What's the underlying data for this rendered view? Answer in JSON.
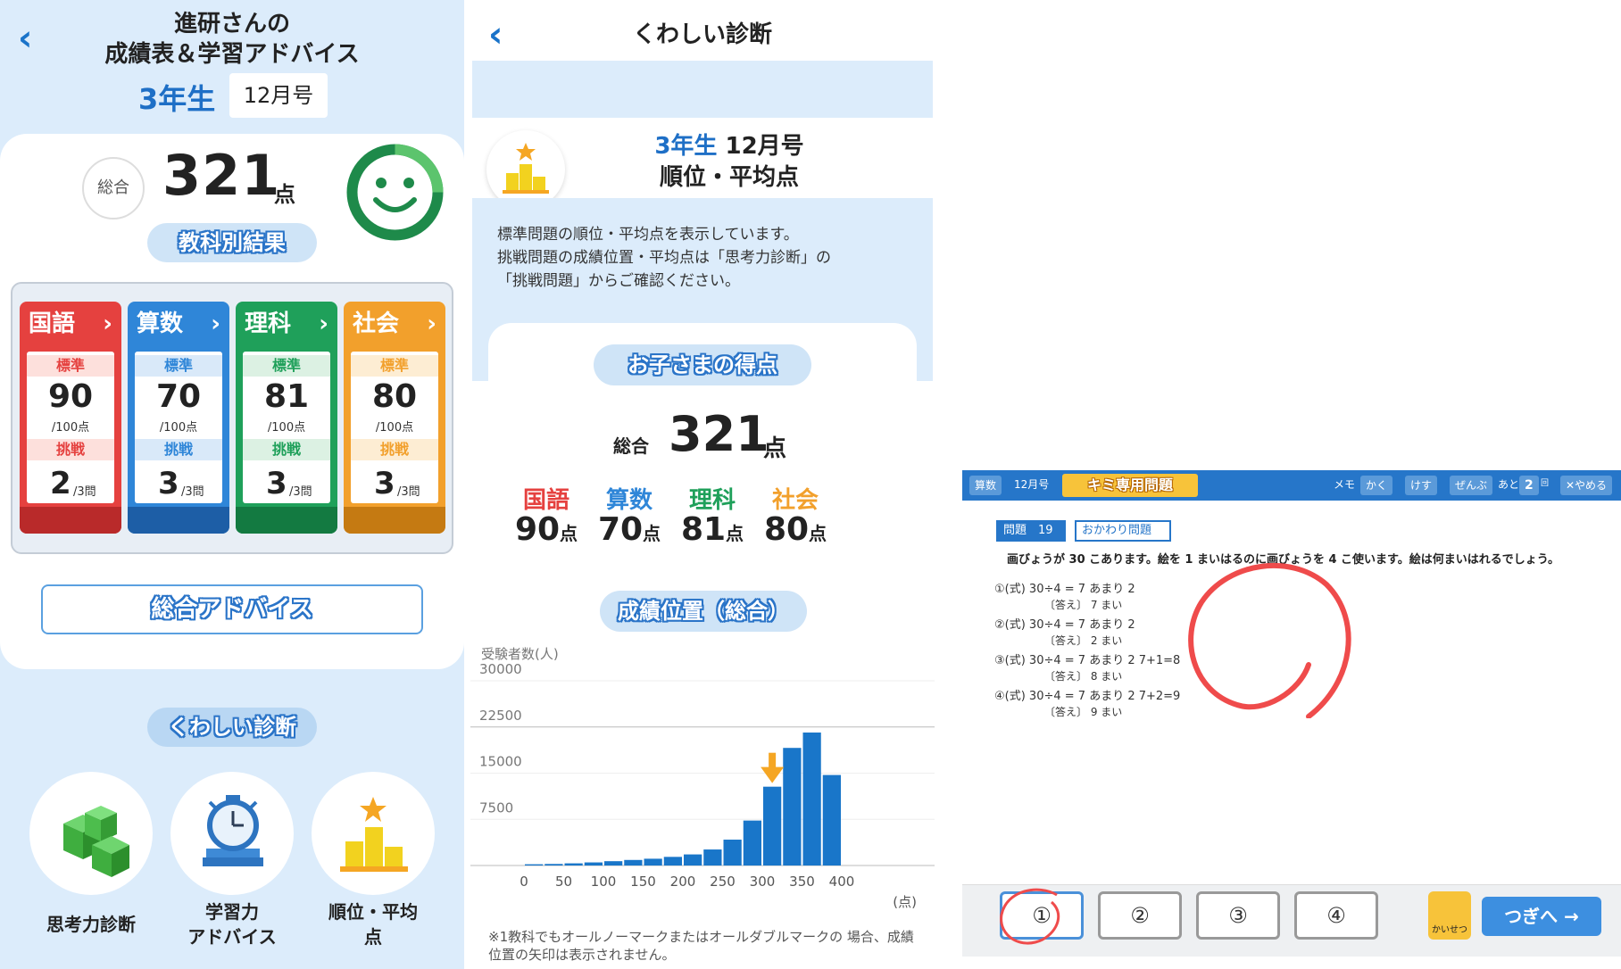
{
  "panel1": {
    "back": "‹",
    "title_line1": "進研さんの",
    "title_line2": "成績表＆学習アドバイス",
    "grade": "3年生",
    "month": "12月号",
    "total_label": "総合",
    "total_score": "321",
    "total_unit": "点",
    "subject_results_label": "教科別結果",
    "subjects": [
      {
        "name": "国語",
        "arrow": "›",
        "std_label": "標準",
        "std_score": "90",
        "std_denom": "/100点",
        "chal_label": "挑戦",
        "chal_score": "2",
        "chal_denom": "/3問",
        "color": "#e5413f",
        "shadow": "#b92a2a",
        "lbl_bg": "#fde0dc",
        "lbl_color": "#e5413f"
      },
      {
        "name": "算数",
        "arrow": "›",
        "std_label": "標準",
        "std_score": "70",
        "std_denom": "/100点",
        "chal_label": "挑戦",
        "chal_score": "3",
        "chal_denom": "/3問",
        "color": "#2f86d8",
        "shadow": "#1d5ea6",
        "lbl_bg": "#d9e9f9",
        "lbl_color": "#2f86d8"
      },
      {
        "name": "理科",
        "arrow": "›",
        "std_label": "標準",
        "std_score": "81",
        "std_denom": "/100点",
        "chal_label": "挑戦",
        "chal_score": "3",
        "chal_denom": "/3問",
        "color": "#1fa05a",
        "shadow": "#137a41",
        "lbl_bg": "#dcf1e3",
        "lbl_color": "#1fa05a"
      },
      {
        "name": "社会",
        "arrow": "›",
        "std_label": "標準",
        "std_score": "80",
        "std_denom": "/100点",
        "chal_label": "挑戦",
        "chal_score": "3",
        "chal_denom": "/3問",
        "color": "#f2a02c",
        "shadow": "#c57a12",
        "lbl_bg": "#fdedd3",
        "lbl_color": "#f2a02c"
      }
    ],
    "advice_label": "総合アドバイス",
    "detail_label": "くわしい診断",
    "diag_items": [
      "思考力診断",
      "学習力\nアドバイス",
      "順位・平均\n点"
    ]
  },
  "panel2": {
    "back": "‹",
    "title": "くわしい診断",
    "header_grade": "3年生",
    "header_month": " 12月号",
    "header_line2": "順位・平均点",
    "info": "標準問題の順位・平均点を表示しています。\n挑戦問題の成績位置・平均点は「思考力診断」の\n「挑戦問題」からご確認ください。",
    "child_score_label": "お子さまの得点",
    "total_label": "総合",
    "total_score": "321",
    "total_unit": "点",
    "subjects": [
      {
        "name": "国語",
        "score": "90",
        "unit": "点",
        "color": "#e5413f"
      },
      {
        "name": "算数",
        "score": "70",
        "unit": "点",
        "color": "#2f86d8"
      },
      {
        "name": "理科",
        "score": "81",
        "unit": "点",
        "color": "#1fa05a"
      },
      {
        "name": "社会",
        "score": "80",
        "unit": "点",
        "color": "#f2a02c"
      }
    ],
    "position_label": "成績位置（総合）",
    "note": "※1教科でもオールノーマークまたはオールダブルマークの 場合、成績位置の矢印は表示されません。"
  },
  "chart_data": {
    "type": "bar",
    "ylabel": "受験者数(人)",
    "xlabel": "(点)",
    "ylim": [
      0,
      30000
    ],
    "yticks": [
      30000,
      22500,
      15000,
      7500
    ],
    "xticks": [
      0,
      50,
      100,
      150,
      200,
      250,
      300,
      350,
      400
    ],
    "bins": [
      0,
      25,
      50,
      75,
      100,
      125,
      150,
      175,
      200,
      225,
      250,
      275,
      300,
      325,
      350,
      375
    ],
    "values": [
      200,
      250,
      350,
      500,
      700,
      900,
      1100,
      1400,
      1800,
      2600,
      4200,
      7300,
      12800,
      19100,
      21600,
      14700
    ],
    "marker_bin": 300,
    "bar_color": "#1976c9",
    "marker_color": "#f5a623"
  },
  "panel3": {
    "subject": "算数",
    "month": "12月号",
    "banner": "キミ専用問題",
    "memo": "メモ",
    "kaku": "かく",
    "kesu": "けす",
    "zenbu": "ぜんぶ",
    "ato": "あと",
    "ato_count": "2",
    "ato_unit": "回",
    "yameru": "✕やめる",
    "q_label": "問題",
    "q_no": "19",
    "okawari": "おかわり問題",
    "question": "画びょうが 30 こあります。絵を 1 まいはるのに画びょうを 4 こ使います。絵は何まいはれるでしょう。",
    "options": [
      {
        "shiki": "①(式)  30÷4 = 7 あまり 2",
        "kotae": "〔答え〕 7 まい"
      },
      {
        "shiki": "②(式)  30÷4 = 7 あまり 2",
        "kotae": "〔答え〕 2 まい"
      },
      {
        "shiki": "③(式)  30÷4 = 7 あまり 2    7+1=8",
        "kotae": "〔答え〕 8 まい"
      },
      {
        "shiki": "④(式)  30÷4 = 7 あまり 2    7+2=9",
        "kotae": "〔答え〕 9 まい"
      }
    ],
    "choices": [
      "①",
      "②",
      "③",
      "④"
    ],
    "help": "かいせつ",
    "next": "つぎへ →"
  }
}
